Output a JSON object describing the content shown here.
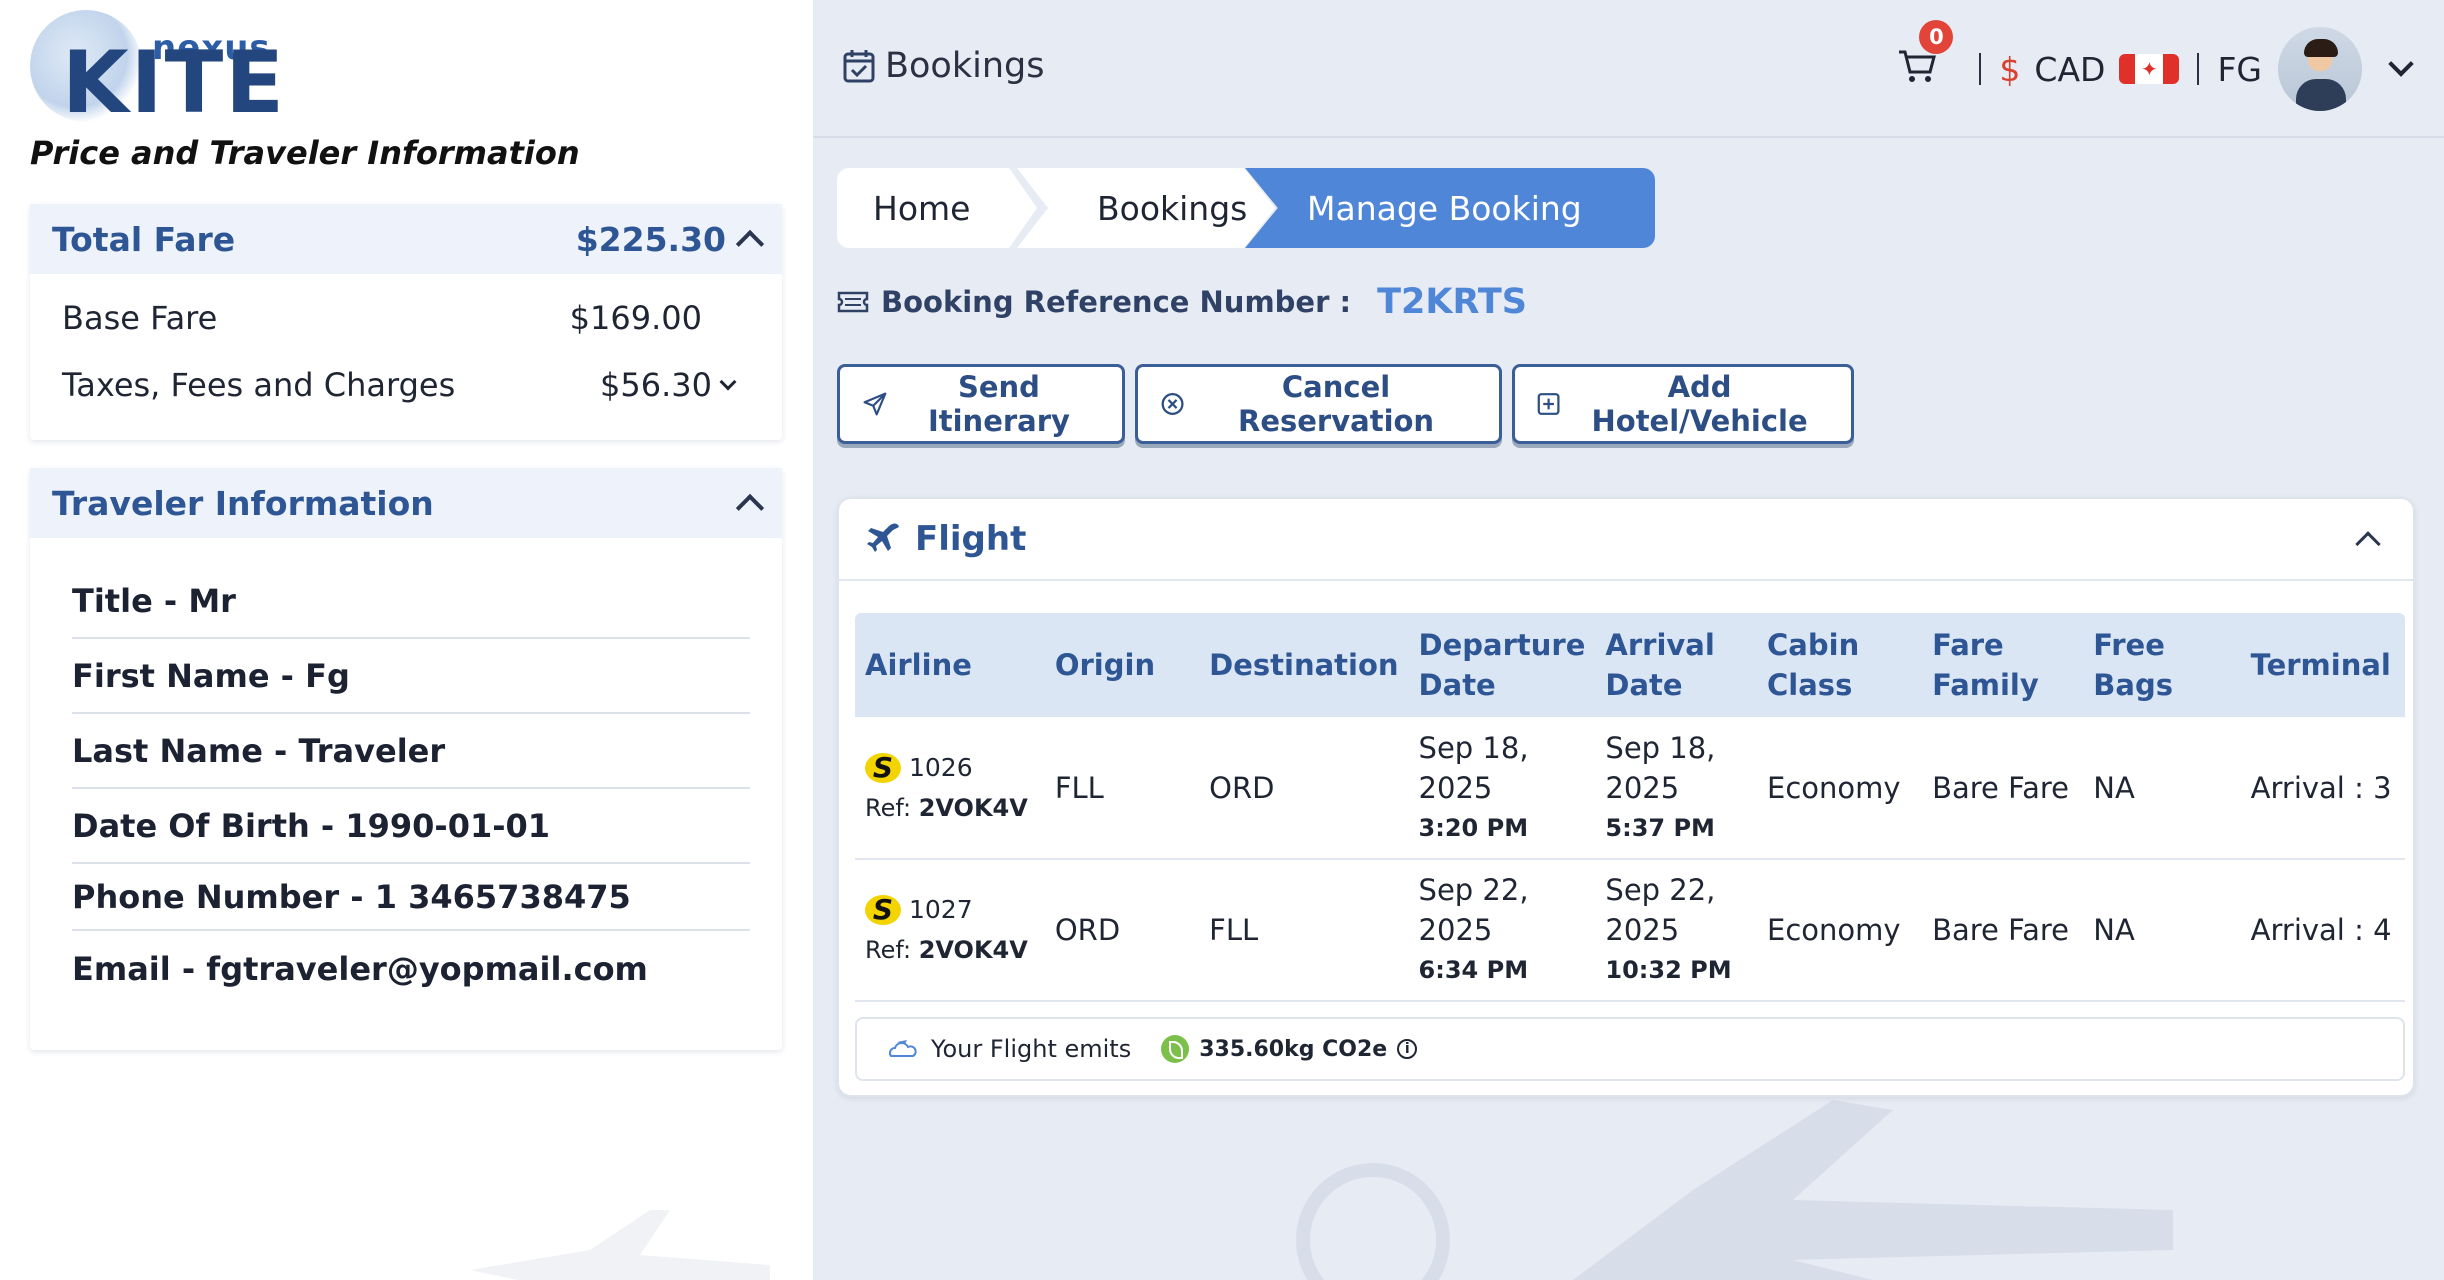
{
  "brand": {
    "top": "nexus",
    "main": "KITE"
  },
  "left": {
    "title": "Price and Traveler Information",
    "fare": {
      "header_label": "Total Fare",
      "total": "$225.30",
      "rows": [
        {
          "label": "Base Fare",
          "value": "$169.00"
        },
        {
          "label": "Taxes, Fees and Charges",
          "value": "$56.30"
        }
      ]
    },
    "traveler": {
      "header_label": "Traveler Information",
      "items": [
        "Title - Mr",
        "First Name - Fg",
        "Last Name - Traveler",
        "Date Of Birth - 1990-01-01",
        "Phone Number - 1 3465738475",
        "Email - fgtraveler@yopmail.com"
      ]
    }
  },
  "header": {
    "page_title": "Bookings",
    "cart_count": "0",
    "currency_symbol": "$",
    "currency": "CAD",
    "user_initials": "FG"
  },
  "breadcrumb": {
    "home": "Home",
    "bookings": "Bookings",
    "current": "Manage Booking"
  },
  "booking": {
    "ref_label": "Booking Reference Number :",
    "ref_value": "T2KRTS"
  },
  "actions": {
    "send": "Send Itinerary",
    "cancel": "Cancel Reservation",
    "add": "Add Hotel/Vehicle"
  },
  "flight": {
    "title": "Flight",
    "columns": {
      "airline": "Airline",
      "origin": "Origin",
      "destination": "Destination",
      "departure_1": "Departure",
      "departure_2": "Date",
      "arrival_1": "Arrival",
      "arrival_2": "Date",
      "cabin_1": "Cabin",
      "cabin_2": "Class",
      "fare_1": "Fare",
      "fare_2": "Family",
      "bags": "Free Bags",
      "terminal": "Terminal"
    },
    "ref_label": "Ref:",
    "rows": [
      {
        "logo": "S",
        "flight_no": "1026",
        "ref": "2VOK4V",
        "origin": "FLL",
        "destination": "ORD",
        "dep_date_1": "Sep 18,",
        "dep_date_2": "2025",
        "dep_time": "3:20 PM",
        "arr_date_1": "Sep 18,",
        "arr_date_2": "2025",
        "arr_time": "5:37 PM",
        "cabin": "Economy",
        "fare_family": "Bare Fare",
        "bags": "NA",
        "terminal": "Arrival : 3"
      },
      {
        "logo": "S",
        "flight_no": "1027",
        "ref": "2VOK4V",
        "origin": "ORD",
        "destination": "FLL",
        "dep_date_1": "Sep 22,",
        "dep_date_2": "2025",
        "dep_time": "6:34 PM",
        "arr_date_1": "Sep 22,",
        "arr_date_2": "2025",
        "arr_time": "10:32 PM",
        "cabin": "Economy",
        "fare_family": "Bare Fare",
        "bags": "NA",
        "terminal": "Arrival : 4"
      }
    ],
    "emission_label": "Your Flight emits",
    "emission_value": "335.60kg CO2e",
    "info_glyph": "i"
  },
  "colors": {
    "accent": "#4f86d8",
    "heading": "#2f5694",
    "badge": "#e2443a"
  }
}
